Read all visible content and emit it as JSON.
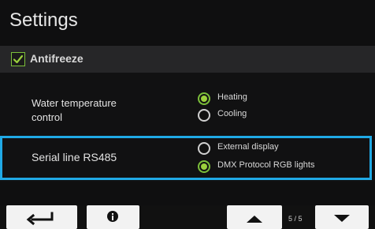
{
  "page": {
    "title": "Settings"
  },
  "antifreeze": {
    "label": "Antifreeze",
    "checked": true
  },
  "water_temperature_control": {
    "title_line_1": "Water temperature",
    "title_line_2": "control",
    "options": [
      {
        "label": "Heating",
        "selected": true
      },
      {
        "label": "Cooling",
        "selected": false
      }
    ]
  },
  "serial_line": {
    "title": "Serial line RS485",
    "options": [
      {
        "label": "External display",
        "selected": false
      },
      {
        "label": "DMX Protocol RGB lights",
        "selected": true
      }
    ]
  },
  "footer": {
    "page_indicator": "5 / 5",
    "buttons": [
      {
        "icon": "back-arrow-icon"
      },
      {
        "icon": "info-icon"
      },
      {
        "icon": "up-arrow-icon"
      },
      {
        "icon": "down-arrow-icon"
      }
    ]
  },
  "colors": {
    "background": "#0f0f10",
    "row_highlight": "#262628",
    "accent_green": "#7bbe3a",
    "focus_blue": "#20a9e5",
    "button_light": "#f2f2f2"
  }
}
